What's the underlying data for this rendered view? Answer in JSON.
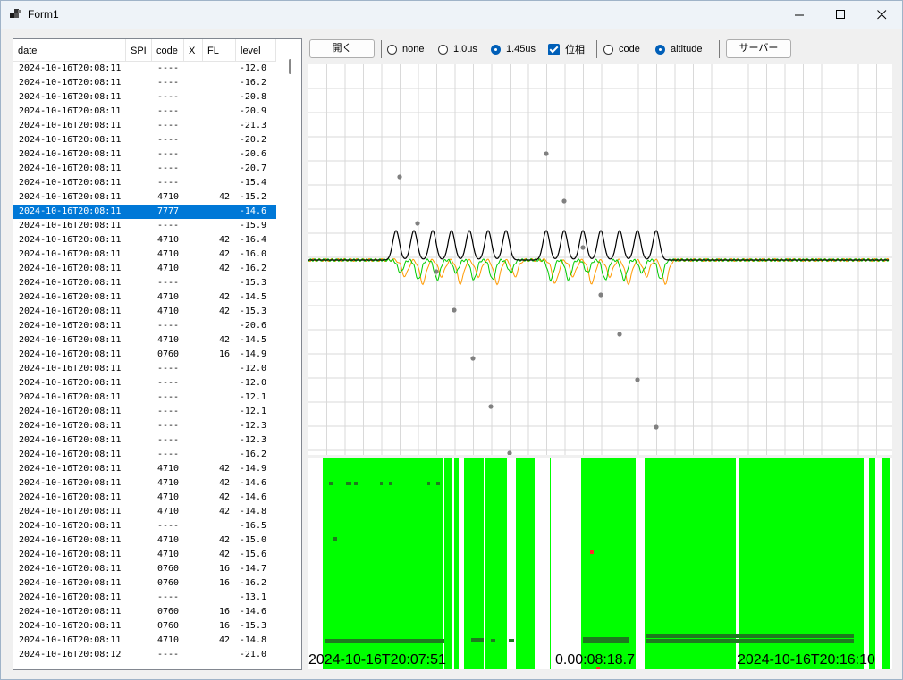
{
  "window": {
    "title": "Form1"
  },
  "list": {
    "columns": [
      "date",
      "SPI",
      "code",
      "X",
      "FL",
      "level"
    ],
    "rows": [
      {
        "date": "2024-10-16T20:08:11",
        "code": "----",
        "fl": "",
        "level": "-12.0"
      },
      {
        "date": "2024-10-16T20:08:11",
        "code": "----",
        "fl": "",
        "level": "-16.2"
      },
      {
        "date": "2024-10-16T20:08:11",
        "code": "----",
        "fl": "",
        "level": "-20.8"
      },
      {
        "date": "2024-10-16T20:08:11",
        "code": "----",
        "fl": "",
        "level": "-20.9"
      },
      {
        "date": "2024-10-16T20:08:11",
        "code": "----",
        "fl": "",
        "level": "-21.3"
      },
      {
        "date": "2024-10-16T20:08:11",
        "code": "----",
        "fl": "",
        "level": "-20.2"
      },
      {
        "date": "2024-10-16T20:08:11",
        "code": "----",
        "fl": "",
        "level": "-20.6"
      },
      {
        "date": "2024-10-16T20:08:11",
        "code": "----",
        "fl": "",
        "level": "-20.7"
      },
      {
        "date": "2024-10-16T20:08:11",
        "code": "----",
        "fl": "",
        "level": "-15.4"
      },
      {
        "date": "2024-10-16T20:08:11",
        "code": "4710",
        "fl": "42",
        "level": "-15.2"
      },
      {
        "date": "2024-10-16T20:08:11",
        "code": "7777",
        "fl": "",
        "level": "-14.6"
      },
      {
        "date": "2024-10-16T20:08:11",
        "code": "----",
        "fl": "",
        "level": "-15.9"
      },
      {
        "date": "2024-10-16T20:08:11",
        "code": "4710",
        "fl": "42",
        "level": "-16.4"
      },
      {
        "date": "2024-10-16T20:08:11",
        "code": "4710",
        "fl": "42",
        "level": "-16.0"
      },
      {
        "date": "2024-10-16T20:08:11",
        "code": "4710",
        "fl": "42",
        "level": "-16.2"
      },
      {
        "date": "2024-10-16T20:08:11",
        "code": "----",
        "fl": "",
        "level": "-15.3"
      },
      {
        "date": "2024-10-16T20:08:11",
        "code": "4710",
        "fl": "42",
        "level": "-14.5"
      },
      {
        "date": "2024-10-16T20:08:11",
        "code": "4710",
        "fl": "42",
        "level": "-15.3"
      },
      {
        "date": "2024-10-16T20:08:11",
        "code": "----",
        "fl": "",
        "level": "-20.6"
      },
      {
        "date": "2024-10-16T20:08:11",
        "code": "4710",
        "fl": "42",
        "level": "-14.5"
      },
      {
        "date": "2024-10-16T20:08:11",
        "code": "0760",
        "fl": "16",
        "level": "-14.9"
      },
      {
        "date": "2024-10-16T20:08:11",
        "code": "----",
        "fl": "",
        "level": "-12.0"
      },
      {
        "date": "2024-10-16T20:08:11",
        "code": "----",
        "fl": "",
        "level": "-12.0"
      },
      {
        "date": "2024-10-16T20:08:11",
        "code": "----",
        "fl": "",
        "level": "-12.1"
      },
      {
        "date": "2024-10-16T20:08:11",
        "code": "----",
        "fl": "",
        "level": "-12.1"
      },
      {
        "date": "2024-10-16T20:08:11",
        "code": "----",
        "fl": "",
        "level": "-12.3"
      },
      {
        "date": "2024-10-16T20:08:11",
        "code": "----",
        "fl": "",
        "level": "-12.3"
      },
      {
        "date": "2024-10-16T20:08:11",
        "code": "----",
        "fl": "",
        "level": "-16.2"
      },
      {
        "date": "2024-10-16T20:08:11",
        "code": "4710",
        "fl": "42",
        "level": "-14.9"
      },
      {
        "date": "2024-10-16T20:08:11",
        "code": "4710",
        "fl": "42",
        "level": "-14.6"
      },
      {
        "date": "2024-10-16T20:08:11",
        "code": "4710",
        "fl": "42",
        "level": "-14.6"
      },
      {
        "date": "2024-10-16T20:08:11",
        "code": "4710",
        "fl": "42",
        "level": "-14.8"
      },
      {
        "date": "2024-10-16T20:08:11",
        "code": "----",
        "fl": "",
        "level": "-16.5"
      },
      {
        "date": "2024-10-16T20:08:11",
        "code": "4710",
        "fl": "42",
        "level": "-15.0"
      },
      {
        "date": "2024-10-16T20:08:11",
        "code": "4710",
        "fl": "42",
        "level": "-15.6"
      },
      {
        "date": "2024-10-16T20:08:11",
        "code": "0760",
        "fl": "16",
        "level": "-14.7"
      },
      {
        "date": "2024-10-16T20:08:11",
        "code": "0760",
        "fl": "16",
        "level": "-16.2"
      },
      {
        "date": "2024-10-16T20:08:11",
        "code": "----",
        "fl": "",
        "level": "-13.1"
      },
      {
        "date": "2024-10-16T20:08:11",
        "code": "0760",
        "fl": "16",
        "level": "-14.6"
      },
      {
        "date": "2024-10-16T20:08:11",
        "code": "0760",
        "fl": "16",
        "level": "-15.3"
      },
      {
        "date": "2024-10-16T20:08:11",
        "code": "4710",
        "fl": "42",
        "level": "-14.8"
      },
      {
        "date": "2024-10-16T20:08:12",
        "code": "----",
        "fl": "",
        "level": "-21.0"
      }
    ],
    "selected_index": 10
  },
  "toolbar": {
    "open_label": "開く",
    "radio_none": "none",
    "radio_10us": "1.0us",
    "radio_145us": "1.45us",
    "phase_label": "位相",
    "radio_code": "code",
    "radio_altitude": "altitude",
    "server_label": "サーバー"
  },
  "state": {
    "interval": "1.45us",
    "phase_checked": true,
    "display_mode": "altitude"
  },
  "timeline": {
    "start": "2024-10-16T20:07:51",
    "cursor": "0.00:08:18.7",
    "end": "2024-10-16T20:16:10"
  },
  "colors": {
    "accent": "#005fb8",
    "selection": "#0078d7",
    "trace_amplitude": "#000000",
    "trace_phase_a": "#ff9900",
    "trace_phase_b": "#00cc00",
    "timeline_fill": "#00ff00",
    "timeline_dark": "#1e7a1e",
    "timeline_marker": "#ff2a2a",
    "grid": "#d9d9d9"
  },
  "icons": {
    "app": "app-icon",
    "minimize": "minimize-icon",
    "maximize": "maximize-icon",
    "close": "close-icon"
  }
}
